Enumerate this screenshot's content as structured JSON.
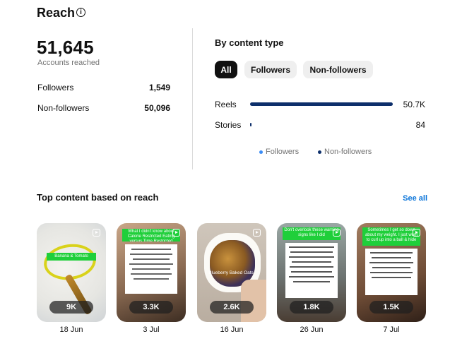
{
  "reach": {
    "title": "Reach",
    "info_icon": "info-icon",
    "total": "51,645",
    "total_label": "Accounts reached",
    "rows": [
      {
        "label": "Followers",
        "value": "1,549"
      },
      {
        "label": "Non-followers",
        "value": "50,096"
      }
    ]
  },
  "content_type": {
    "title": "By content type",
    "filters": [
      {
        "label": "All",
        "active": true
      },
      {
        "label": "Followers",
        "active": false
      },
      {
        "label": "Non-followers",
        "active": false
      }
    ],
    "bars": [
      {
        "label": "Reels",
        "value": "50.7K",
        "fraction": 1.0
      },
      {
        "label": "Stories",
        "value": "84",
        "fraction": 0.0017
      }
    ],
    "legend": [
      {
        "label": "Followers",
        "color": "#3b8cf5"
      },
      {
        "label": "Non-followers",
        "color": "#0d2f6b"
      }
    ]
  },
  "top_content": {
    "title": "Top content based on reach",
    "see_all": "See all",
    "items": [
      {
        "count": "9K",
        "date": "18 Jun",
        "caption": "Banana & Tomato Sandwich",
        "icon": "reel-icon"
      },
      {
        "count": "3.3K",
        "date": "3 Jul",
        "caption": "What I didn't know about Calorie Restricted Eating versus Time Restricted Eating",
        "icon": "reel-icon"
      },
      {
        "count": "2.6K",
        "date": "16 Jun",
        "caption": "Blueberry Baked Oats",
        "icon": "reel-icon"
      },
      {
        "count": "1.8K",
        "date": "26 Jun",
        "caption": "Don't overlook these warning signs like I did",
        "icon": "reel-icon"
      },
      {
        "count": "1.5K",
        "date": "7 Jul",
        "caption": "Sometimes I get so down about my weight. I just want to curl up into a ball & hide",
        "icon": "reel-icon"
      }
    ]
  }
}
